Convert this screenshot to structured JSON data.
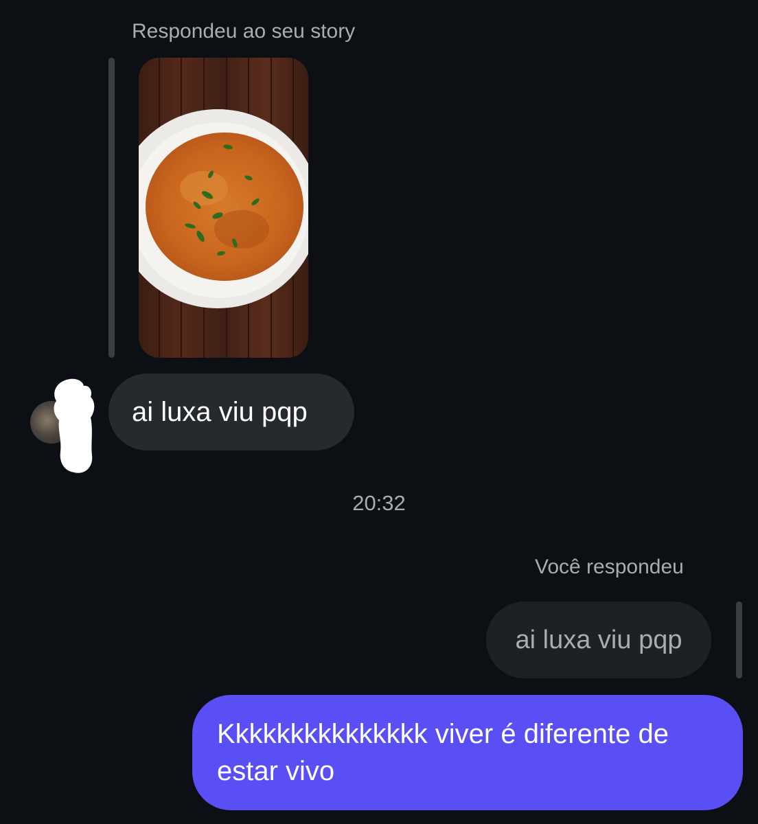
{
  "incoming": {
    "reply_context_label": "Respondeu ao seu story",
    "message_text": "ai luxa viu pqp"
  },
  "timestamp": "20:32",
  "outgoing": {
    "reply_context_label": "Você respondeu",
    "quoted_text": "ai luxa viu pqp",
    "message_text": "Kkkkkkkkkkkkkkk viver é diferente de estar vivo"
  },
  "colors": {
    "background": "#0c1014",
    "incoming_bubble": "#262a2f",
    "quoted_bubble": "#1d2125",
    "outgoing_bubble": "#5a4ef5",
    "secondary_text": "#a8adb4"
  }
}
